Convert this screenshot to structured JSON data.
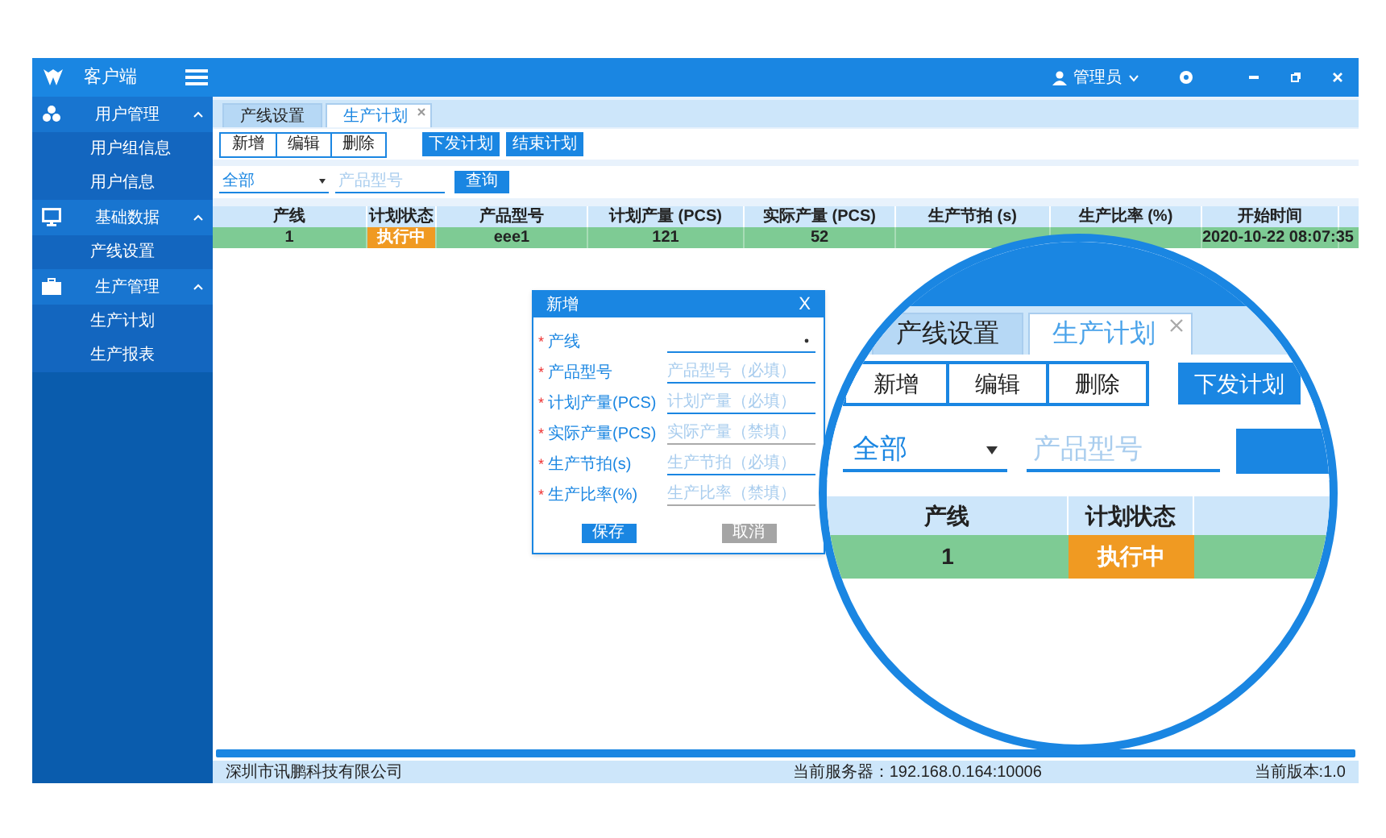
{
  "app": {
    "title": "客户端"
  },
  "user": {
    "name": "管理员"
  },
  "sidebar": {
    "groups": [
      {
        "label": "用户管理",
        "expanded": true,
        "children": [
          {
            "label": "用户组信息"
          },
          {
            "label": "用户信息"
          }
        ]
      },
      {
        "label": "基础数据",
        "expanded": true,
        "children": [
          {
            "label": "产线设置"
          }
        ]
      },
      {
        "label": "生产管理",
        "expanded": true,
        "children": [
          {
            "label": "生产计划"
          },
          {
            "label": "生产报表"
          }
        ]
      }
    ]
  },
  "tabs": [
    {
      "label": "产线设置",
      "selected": false,
      "closable": false
    },
    {
      "label": "生产计划",
      "selected": true,
      "closable": true
    }
  ],
  "toolbar": {
    "group": [
      "新增",
      "编辑",
      "删除"
    ],
    "actions": [
      "下发计划",
      "结束计划"
    ]
  },
  "filter": {
    "select": "全部",
    "placeholder": "产品型号",
    "button": "查询"
  },
  "table": {
    "columns": [
      "产线",
      "计划状态",
      "产品型号",
      "计划产量 (PCS)",
      "实际产量 (PCS)",
      "生产节拍 (s)",
      "生产比率 (%)",
      "开始时间"
    ],
    "rows": [
      {
        "line": "1",
        "status": "执行中",
        "product": "eee1",
        "planned": "121",
        "actual": "52",
        "start_time": "2020-10-22 08:07:35"
      }
    ]
  },
  "dialog": {
    "title": "新增",
    "close": "X",
    "required_mark": "*",
    "fields": [
      {
        "kind": "select",
        "label": "产线",
        "required": true,
        "disabled": false
      },
      {
        "kind": "text",
        "label": "产品型号",
        "placeholder": "产品型号（必填）",
        "required": true,
        "disabled": false
      },
      {
        "kind": "text",
        "label": "计划产量(PCS)",
        "placeholder": "计划产量（必填）",
        "required": true,
        "disabled": false
      },
      {
        "kind": "text",
        "label": "实际产量(PCS)",
        "placeholder": "实际产量（禁填）",
        "required": true,
        "disabled": true
      },
      {
        "kind": "text",
        "label": "生产节拍(s)",
        "placeholder": "生产节拍（必填）",
        "required": true,
        "disabled": false
      },
      {
        "kind": "text",
        "label": "生产比率(%)",
        "placeholder": "生产比率（禁填）",
        "required": true,
        "disabled": true
      }
    ],
    "buttons": [
      {
        "label": "保存",
        "kind": "primary"
      },
      {
        "label": "取消",
        "kind": "secondary"
      }
    ]
  },
  "magnifier": {
    "tabs": [
      {
        "label": "产线设置",
        "selected": false,
        "closable": false
      },
      {
        "label": "生产计划",
        "selected": true,
        "closable": true
      }
    ],
    "toolbar": {
      "group": [
        "新增",
        "编辑",
        "删除"
      ],
      "actions": [
        "下发计划"
      ]
    },
    "filter": {
      "select": "全部",
      "placeholder": "产品型号"
    },
    "table": {
      "columns": [
        "产线",
        "计划状态"
      ],
      "rows": [
        {
          "line": "1",
          "status": "执行中"
        }
      ]
    }
  },
  "status_bar": {
    "company": "深圳市讯鹏科技有限公司",
    "server": "当前服务器：192.168.0.164:10006",
    "version": "当前版本:1.0"
  }
}
